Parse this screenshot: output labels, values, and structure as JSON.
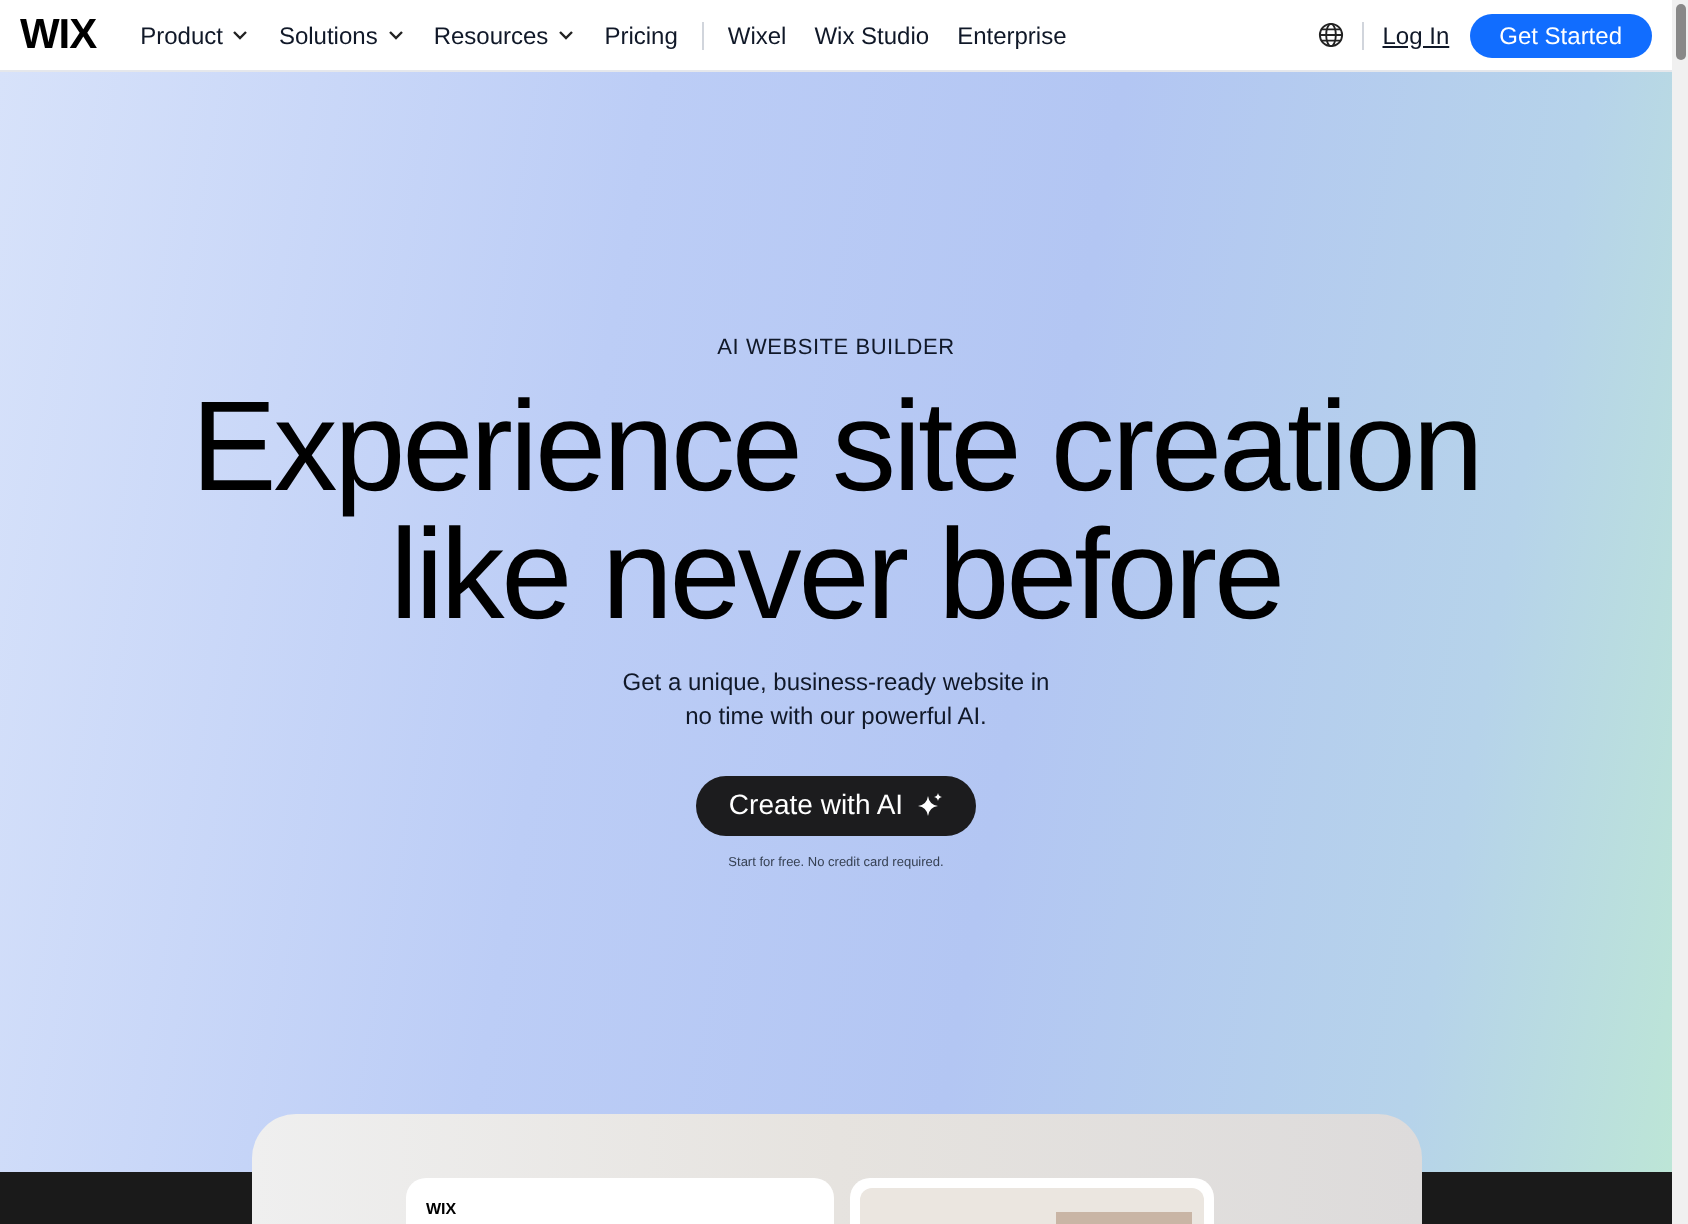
{
  "nav": {
    "logo": "WIX",
    "items": [
      {
        "label": "Product",
        "dropdown": true
      },
      {
        "label": "Solutions",
        "dropdown": true
      },
      {
        "label": "Resources",
        "dropdown": true
      },
      {
        "label": "Pricing",
        "dropdown": false
      }
    ],
    "secondary_items": [
      "Wixel",
      "Wix Studio",
      "Enterprise"
    ],
    "login": "Log In",
    "cta": "Get Started"
  },
  "hero": {
    "eyebrow": "AI WEBSITE BUILDER",
    "headline_lines": [
      "Experience site creation",
      "like never before"
    ],
    "subtitle_lines": [
      "Get a unique, business-ready website in",
      "no time with our powerful AI."
    ],
    "button": "Create with AI",
    "note": "Start for free. No credit card required."
  },
  "preview": {
    "left_card_logo": "WIX"
  }
}
